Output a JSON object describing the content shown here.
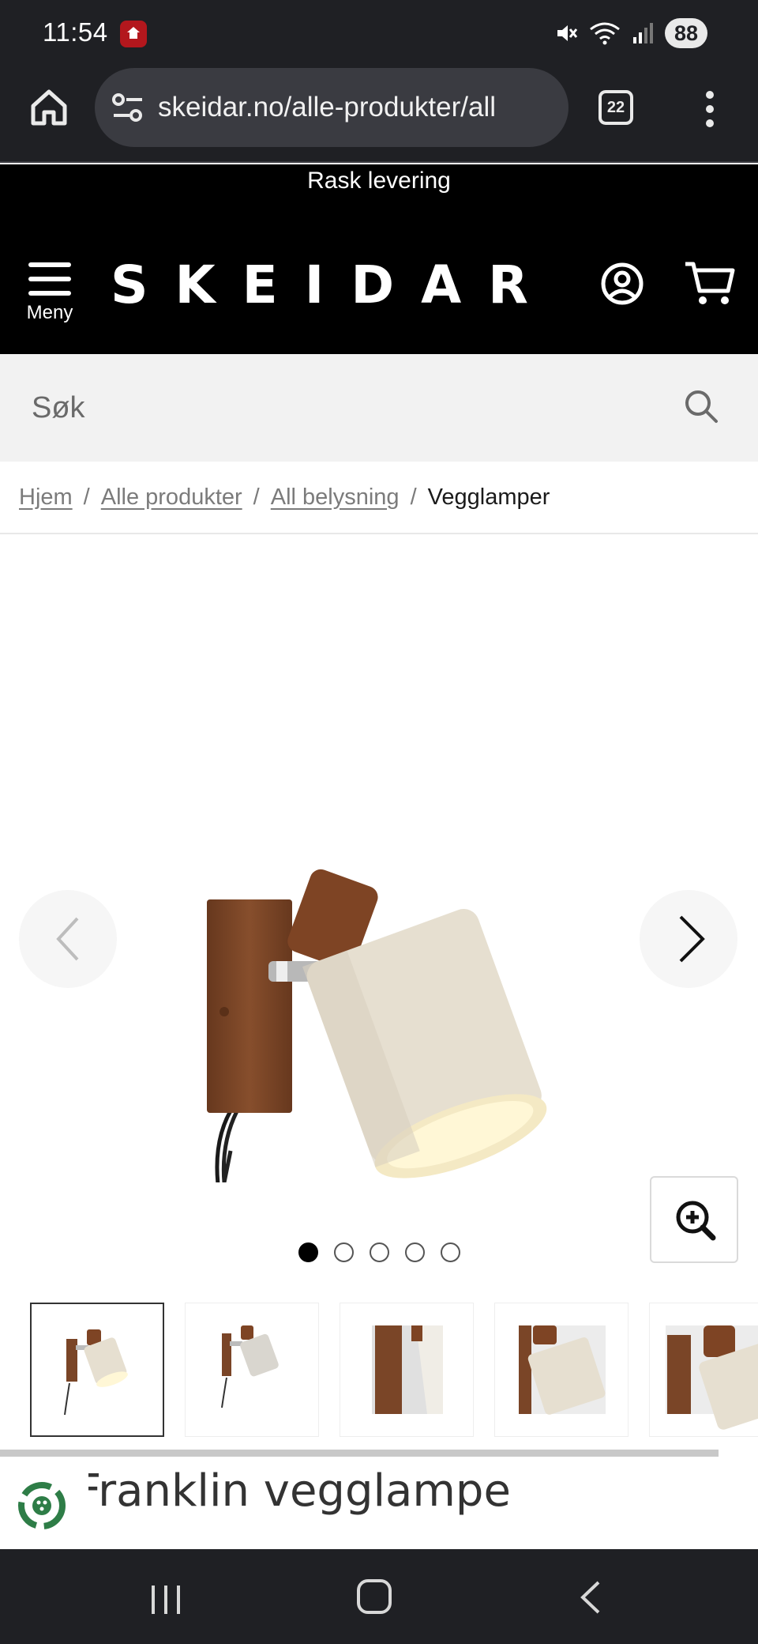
{
  "status": {
    "time": "11:54",
    "battery": "88"
  },
  "browser": {
    "url": "skeidar.no/alle-produkter/all",
    "tab_count": "22"
  },
  "promo": {
    "text": "Rask levering"
  },
  "header": {
    "menu_label": "Meny",
    "logo": "SKEIDAR"
  },
  "search": {
    "placeholder": "Søk"
  },
  "breadcrumb": {
    "items": [
      "Hjem",
      "Alle produkter",
      "All belysning"
    ],
    "current": "Vegglamper"
  },
  "gallery": {
    "dot_count": 5,
    "active_dot": 0,
    "thumb_count": 5,
    "selected_thumb": 0
  },
  "product": {
    "title": "Franklin vegglampe"
  },
  "colors": {
    "system_bar": "#1f2024",
    "header_bg": "#000000",
    "search_bg": "#f2f2f2",
    "wood": "#7a4527",
    "shade": "#e8e1d3",
    "eco_green": "#2e7d47"
  }
}
